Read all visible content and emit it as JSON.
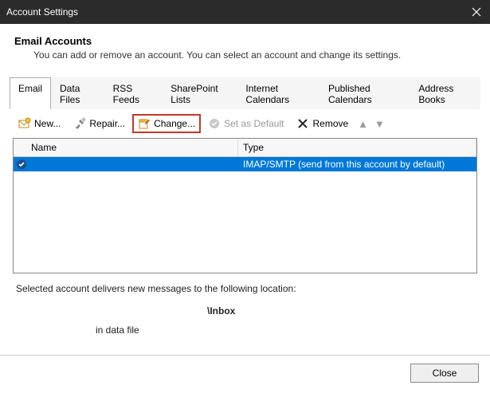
{
  "window": {
    "title": "Account Settings"
  },
  "header": {
    "heading": "Email Accounts",
    "sub": "You can add or remove an account. You can select an account and change its settings."
  },
  "tabs": [
    "Email",
    "Data Files",
    "RSS Feeds",
    "SharePoint Lists",
    "Internet Calendars",
    "Published Calendars",
    "Address Books"
  ],
  "toolbar": {
    "new": "New...",
    "repair": "Repair...",
    "change": "Change...",
    "setdefault": "Set as Default",
    "remove": "Remove"
  },
  "grid": {
    "cols": {
      "name": "Name",
      "type": "Type"
    },
    "rows": [
      {
        "name": "",
        "type": "IMAP/SMTP (send from this account by default)"
      }
    ]
  },
  "delivery": {
    "line1": "Selected account delivers new messages to the following location:",
    "location": "\\Inbox",
    "indatafile": "in data file"
  },
  "footer": {
    "close": "Close"
  }
}
